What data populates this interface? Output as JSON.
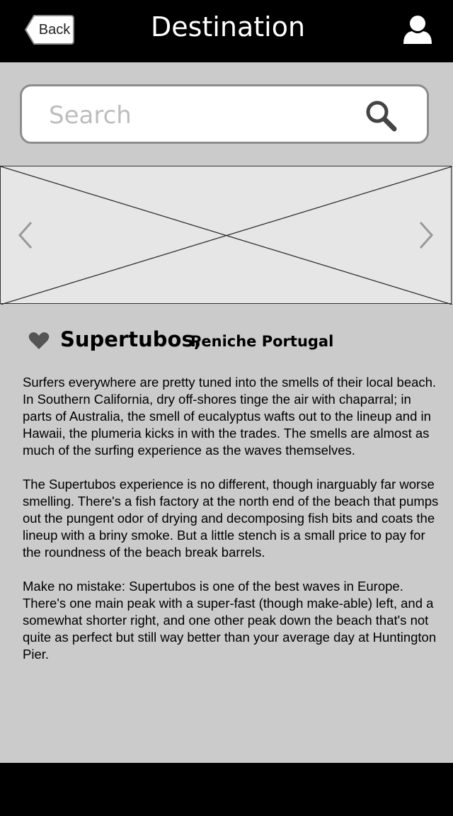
{
  "header": {
    "back_label": "Back",
    "title": "Destination",
    "user_icon": "user-icon"
  },
  "search": {
    "placeholder": "Search",
    "value": "",
    "icon": "search-icon"
  },
  "carousel": {
    "prev_icon": "chevron-left-icon",
    "next_icon": "chevron-right-icon"
  },
  "destination": {
    "favorite_icon": "heart-icon",
    "name": "Supertubos,",
    "location": "Peniche Portugal",
    "paragraphs": [
      "Surfers everywhere are pretty tuned into the smells of their local beach. In Southern California, dry off-shores tinge the air with chaparral; in parts of Australia, the smell of eucalyptus wafts out to the lineup and in Hawaii, the plumeria kicks in with the trades. The smells are almost as much of the surfing experience as the waves themselves.",
      "The Supertubos experience is no different, though inarguably far worse smelling. There's a fish factory at the north end of the beach that pumps out the pungent odor of drying and decomposing fish bits and coats the lineup with a briny smoke. But a little stench is a small price to pay for the roundness of the beach break barrels.",
      "Make no mistake: Supertubos is one of the best waves in Europe. There's one main peak with a super-fast (though make-able) left, and a somewhat shorter right, and one other peak down the beach that's not quite as perfect but still way better than your average day at Huntington Pier."
    ]
  },
  "colors": {
    "bar": "#000000",
    "background": "#cbcbcb",
    "image_placeholder": "#e6e6e6"
  }
}
